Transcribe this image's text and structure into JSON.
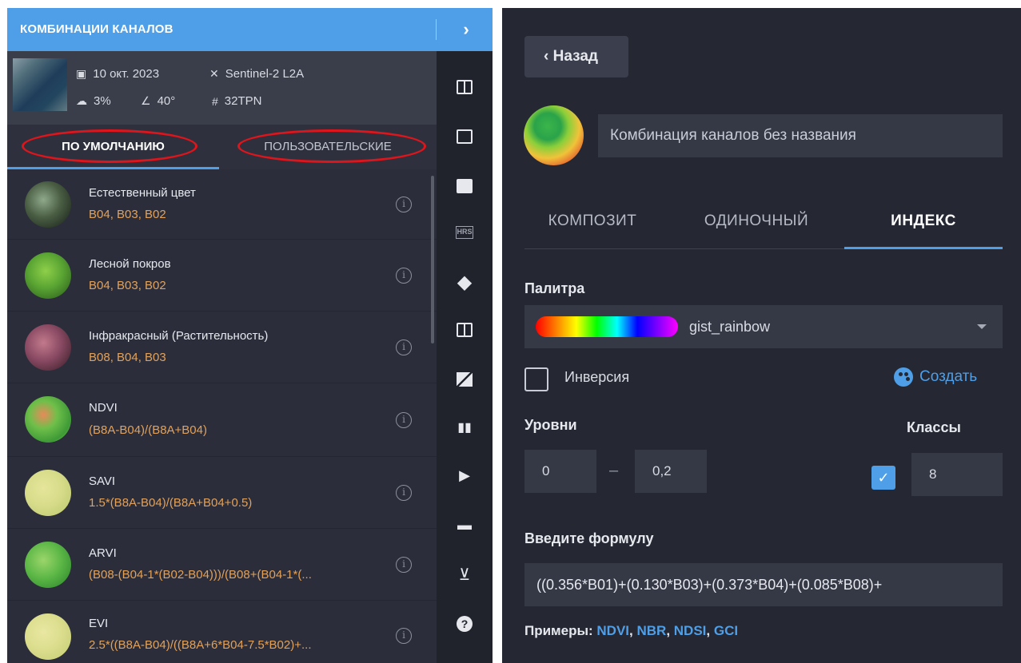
{
  "left_panel": {
    "title": "КОМБИНАЦИИ КАНАЛОВ",
    "expand_icon": "›",
    "scene": {
      "date": "10 окт. 2023",
      "satellite": "Sentinel-2 L2A",
      "cloud": "3%",
      "angle": "40°",
      "tile": "32TPN"
    },
    "tabs": {
      "default": "ПО УМОЛЧАНИЮ",
      "custom": "ПОЛЬЗОВАТЕЛЬСКИЕ"
    },
    "items": [
      {
        "name": "Естественный цвет",
        "bands": "B04, B03, B02"
      },
      {
        "name": "Лесной покров",
        "bands": "B04, B03, B02"
      },
      {
        "name": "Інфракрасный (Растительность)",
        "bands": "B08, B04, B03"
      },
      {
        "name": "NDVI",
        "bands": "(B8A-B04)/(B8A+B04)"
      },
      {
        "name": "SAVI",
        "bands": "1.5*(B8A-B04)/(B8A+B04+0.5)"
      },
      {
        "name": "ARVI",
        "bands": "(B08-(B04-1*(B02-B04)))/(B08+(B04-1*(..."
      },
      {
        "name": "EVI",
        "bands": "2.5*((B8A-B04)/((B8A+6*B04-7.5*B02)+..."
      }
    ],
    "info_glyph": "i",
    "rail_icons": [
      "compare-icon",
      "crop-icon",
      "image-icon",
      "hrs-icon",
      "layers-icon",
      "split-icon",
      "mosaic-icon",
      "chart-icon",
      "play-icon",
      "notes-icon",
      "cart-icon",
      "help-icon"
    ],
    "rail_labels": {
      "hrs": "HRS",
      "help": "?"
    }
  },
  "right_panel": {
    "back_label": "Назад",
    "name_placeholder": "Комбинация каналов без названия",
    "tabs": {
      "composite": "КОМПОЗИТ",
      "single": "ОДИНОЧНЫЙ",
      "index": "ИНДЕКС"
    },
    "palette_label": "Палитра",
    "palette_value": "gist_rainbow",
    "inversion_label": "Инверсия",
    "inversion_checked": false,
    "create_label": "Создать",
    "levels_label": "Уровни",
    "classes_label": "Классы",
    "level_min": "0",
    "level_sep": "–",
    "level_max": "0,2",
    "classes_checked": true,
    "classes_count": "8",
    "formula_label": "Введите формулу",
    "formula_value": "((0.356*B01)+(0.130*B03)+(0.373*B04)+(0.085*B08)+",
    "examples_label": "Примеры:",
    "examples": [
      "NDVI",
      "NBR",
      "NDSI",
      "GCI"
    ],
    "accent_color": "#4e9fe8",
    "highlight_color": "#e0141b"
  }
}
